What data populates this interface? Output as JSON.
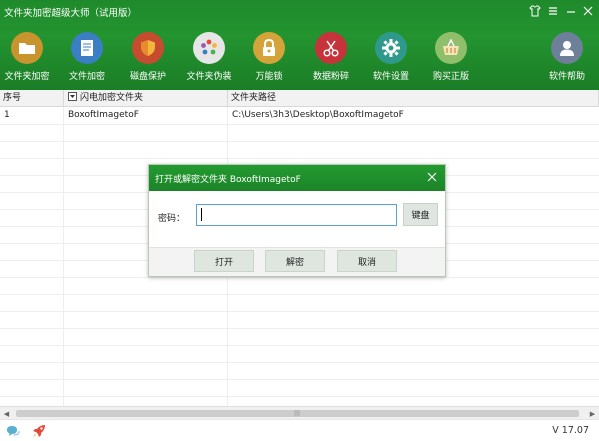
{
  "app": {
    "title": "文件夹加密超级大师（试用版）"
  },
  "window_controls": {
    "shirt_icon": "shirt-icon",
    "menu_icon": "menu-icon",
    "minimize_icon": "minimize-icon",
    "close_icon": "close-icon"
  },
  "toolbar": {
    "items": [
      {
        "label": "文件夹加密",
        "icon": "folder-icon",
        "color": "#c9932e"
      },
      {
        "label": "文件加密",
        "icon": "document-icon",
        "color": "#3a7fc4"
      },
      {
        "label": "磁盘保护",
        "icon": "shield-icon",
        "color": "#c74b2e"
      },
      {
        "label": "文件夹伪装",
        "icon": "palette-icon",
        "color": "#e6e6e6"
      },
      {
        "label": "万能锁",
        "icon": "padlock-icon",
        "color": "#d4a33a"
      },
      {
        "label": "数据粉碎",
        "icon": "scissors-icon",
        "color": "#c7333a"
      },
      {
        "label": "软件设置",
        "icon": "gear-icon",
        "color": "#2f9a8c"
      },
      {
        "label": "购买正版",
        "icon": "basket-icon",
        "color": "#8fbf6a"
      },
      {
        "label": "软件帮助",
        "icon": "user-help-icon",
        "color": "#6d7f99"
      }
    ]
  },
  "table": {
    "columns": [
      "序号",
      "闪电加密文件夹",
      "文件夹路径"
    ],
    "rows": [
      {
        "index": "1",
        "name": "BoxoftImagetoF",
        "path": "C:\\Users\\3h3\\Desktop\\BoxoftImagetoF"
      }
    ]
  },
  "dialog": {
    "title": "打开或解密文件夹 BoxoftImagetoF",
    "password_label": "密码：",
    "password_value": "",
    "keyboard_button": "键盘",
    "open_button": "打开",
    "decrypt_button": "解密",
    "cancel_button": "取消"
  },
  "statusbar": {
    "version": "V 17.07"
  },
  "colors": {
    "header_green": "#1f8a2c",
    "dialog_title_green": "#239a30",
    "input_border": "#5aa0d8"
  }
}
